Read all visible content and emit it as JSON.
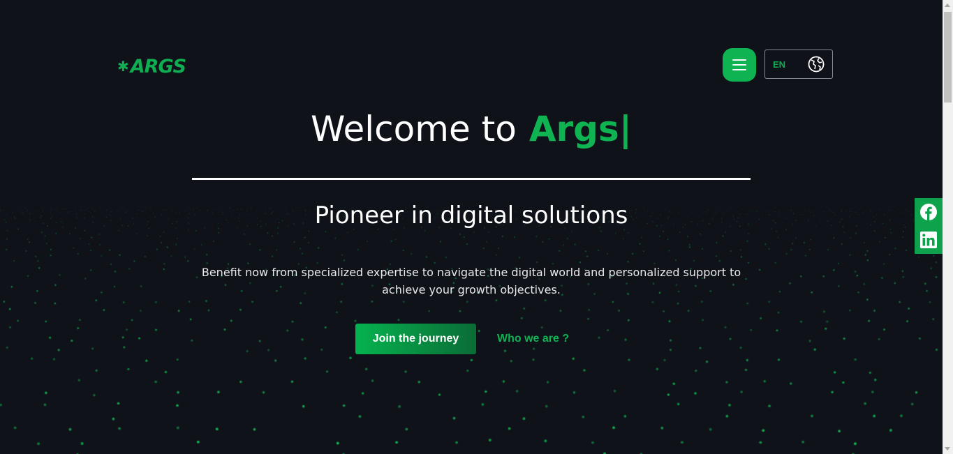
{
  "brand": {
    "logo_text": "ARGS",
    "logo_icon": "clover-icon"
  },
  "header": {
    "menu_icon": "hamburger-icon",
    "language": "EN",
    "language_icon": "globe-icon"
  },
  "hero": {
    "title_prefix": "Welcome to",
    "title_highlight": "Args",
    "cursor": "|",
    "subtitle": "Pioneer in digital solutions",
    "description": "Benefit now from specialized expertise to navigate the digital world and personalized support to achieve your growth objectives.",
    "primary_button": "Join the journey",
    "secondary_link": "Who we are ?"
  },
  "social": [
    {
      "name": "facebook-icon"
    },
    {
      "name": "linkedin-icon"
    }
  ],
  "colors": {
    "background": "#10121a",
    "accent": "#0fb352",
    "dots": "#12c95a"
  }
}
